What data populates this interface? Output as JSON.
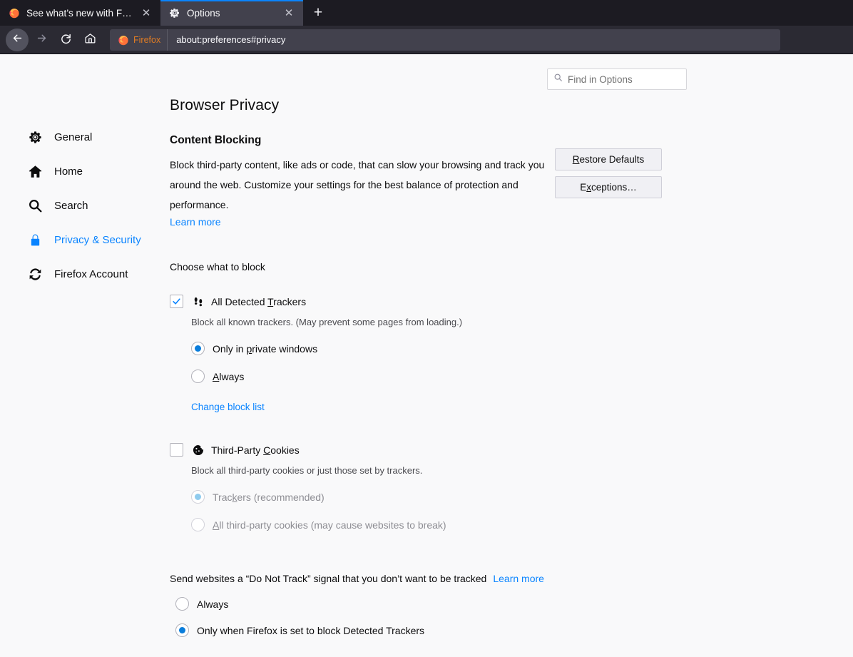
{
  "browser": {
    "tabs": [
      {
        "title": "See what’s new with Firefox",
        "icon": "firefox-logo-icon",
        "active": false
      },
      {
        "title": "Options",
        "icon": "gear-icon",
        "active": true
      }
    ],
    "new_tab_label": "+",
    "close_label": "✕",
    "nav": {
      "back": "back-arrow-icon",
      "forward": "forward-arrow-icon",
      "reload": "reload-icon",
      "home": "home-icon"
    },
    "urlbar": {
      "identity_label": "Firefox",
      "url": "about:preferences#privacy"
    }
  },
  "search": {
    "placeholder": "Find in Options",
    "icon": "search-icon"
  },
  "sidebar": {
    "items": [
      {
        "label": "General",
        "icon": "gear-icon",
        "selected": false
      },
      {
        "label": "Home",
        "icon": "home-icon",
        "selected": false
      },
      {
        "label": "Search",
        "icon": "search-icon",
        "selected": false
      },
      {
        "label": "Privacy & Security",
        "icon": "lock-icon",
        "selected": true
      },
      {
        "label": "Firefox Account",
        "icon": "sync-icon",
        "selected": false
      }
    ]
  },
  "main": {
    "page_title": "Browser Privacy",
    "content_blocking": {
      "heading": "Content Blocking",
      "description": "Block third-party content, like ads or code, that can slow your browsing and track you around the web. Customize your settings for the best balance of protection and performance.",
      "learn_more": "Learn more",
      "buttons": {
        "restore_defaults": {
          "accel": "R",
          "rest": "estore Defaults"
        },
        "exceptions": {
          "pre": "E",
          "accel": "x",
          "rest": "ceptions…"
        }
      },
      "choose_label": "Choose what to block",
      "trackers": {
        "label_pre": "All Detected ",
        "label_accel": "T",
        "label_rest": "rackers",
        "checked": true,
        "icon": "footprints-icon",
        "description": "Block all known trackers. (May prevent some pages from loading.)",
        "options": [
          {
            "pre": "Only in ",
            "accel": "p",
            "rest": "rivate windows",
            "selected": true
          },
          {
            "pre": "",
            "accel": "A",
            "rest": "lways",
            "selected": false
          }
        ],
        "change_block_list": "Change block list"
      },
      "cookies": {
        "label_pre": "Third-Party ",
        "label_accel": "C",
        "label_rest": "ookies",
        "checked": false,
        "icon": "cookie-icon",
        "description": "Block all third-party cookies or just those set by trackers.",
        "options": [
          {
            "pre": "Trac",
            "accel": "k",
            "rest": "ers (recommended)",
            "selected": true,
            "disabled": true
          },
          {
            "pre": "",
            "accel": "A",
            "rest": "ll third-party cookies (may cause websites to break)",
            "selected": false,
            "disabled": true
          }
        ]
      }
    },
    "do_not_track": {
      "text": "Send websites a “Do Not Track” signal that you don’t want to be tracked",
      "learn_more": "Learn more",
      "options": [
        {
          "label": "Always",
          "selected": false
        },
        {
          "label": "Only when Firefox is set to block Detected Trackers",
          "selected": true
        }
      ]
    }
  },
  "colors": {
    "accent": "#0a84ff",
    "chrome_dark": "#1c1b22",
    "toolbar": "#2b2a33",
    "page_bg": "#f9f9fa",
    "identity_orange": "#e07c24"
  }
}
